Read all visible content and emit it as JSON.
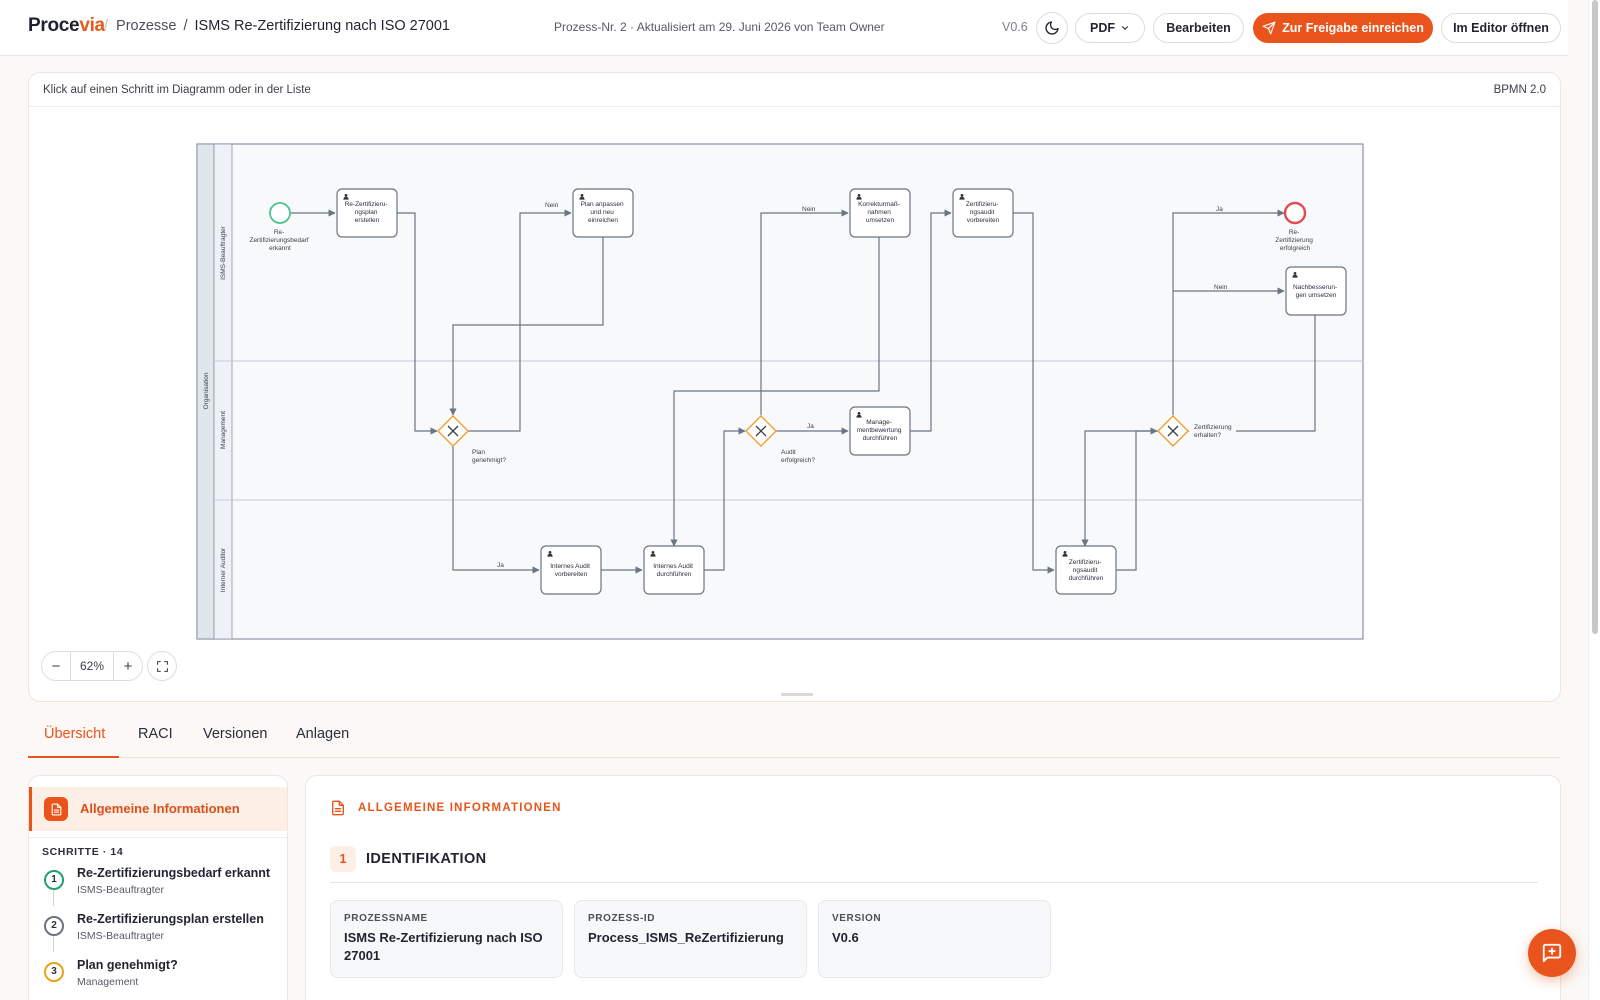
{
  "header": {
    "logo_main": "Proce",
    "logo_accent": "via",
    "breadcrumb_parent": "Prozesse",
    "breadcrumb_current": "ISMS Re-Zertifizierung nach ISO 27001",
    "meta": "Prozess-Nr. 2 · Aktualisiert am 29. Juni 2026 von Team Owner",
    "version": "V0.6",
    "pdf_label": "PDF",
    "edit_label": "Bearbeiten",
    "submit_label": "Zur Freigabe einreichen",
    "open_editor_label": "Im Editor öffnen"
  },
  "diagram": {
    "hint": "Klick auf einen Schritt im Diagramm oder in der Liste",
    "notation": "BPMN 2.0",
    "zoom": "62%",
    "pool": "Organisation",
    "lanes": [
      "ISMS-Beauftragter",
      "Management",
      "Interner Auditor"
    ],
    "start_event": [
      "Re-",
      "Zertifizierungsbedarf",
      "erkannt"
    ],
    "end_event": [
      "Re-",
      "Zertifizierung",
      "erfolgreich"
    ],
    "tasks": {
      "plan": [
        "Re-Zertifizieru-",
        "ngsplan",
        "erstellen"
      ],
      "anpassen": [
        "Plan anpassen",
        "und neu",
        "einreichen"
      ],
      "korrektur": [
        "Korrekturmaß-",
        "nahmen",
        "umsetzen"
      ],
      "zvorbereiten": [
        "Zertifizieru-",
        "ngsaudit",
        "vorbereiten"
      ],
      "nachbessern": [
        "Nachbesserun-",
        "gen umsetzen"
      ],
      "mgmt": [
        "Manage-",
        "mentbewertung",
        "durchführen"
      ],
      "iavorbereiten": [
        "Internes Audit",
        "vorbereiten"
      ],
      "iadurch": [
        "Internes Audit",
        "durchführen"
      ],
      "zdurch": [
        "Zertifizieru-",
        "ngsaudit",
        "durchführen"
      ]
    },
    "gateways": {
      "g1": [
        "Plan",
        "genehmigt?"
      ],
      "g2": [
        "Audit",
        "erfolgreich?"
      ],
      "g3": [
        "Zertifizierung",
        "erhalten?"
      ]
    },
    "flow_labels": {
      "yes": "Ja",
      "no": "Nein"
    }
  },
  "tabs": [
    "Übersicht",
    "RACI",
    "Versionen",
    "Anlagen"
  ],
  "sidebar": {
    "general_info": "Allgemeine Informationen",
    "steps_heading": "SCHRITTE · 14",
    "steps": [
      {
        "num": "1",
        "title": "Re-Zertifizierungsbedarf erkannt",
        "role": "ISMS-Beauftragter",
        "color": "#22a06b"
      },
      {
        "num": "2",
        "title": "Re-Zertifizierungsplan erstellen",
        "role": "ISMS-Beauftragter",
        "color": "#6b7280"
      },
      {
        "num": "3",
        "title": "Plan genehmigt?",
        "role": "Management",
        "color": "#e8a317"
      }
    ]
  },
  "main": {
    "section_title": "ALLGEMEINE INFORMATIONEN",
    "ident_num": "1",
    "ident_title": "IDENTIFIKATION",
    "fields": [
      {
        "label": "PROZESSNAME",
        "value": "ISMS Re-Zertifizierung nach ISO 27001"
      },
      {
        "label": "PROZESS-ID",
        "value": "Process_ISMS_ReZertifizierung"
      },
      {
        "label": "VERSION",
        "value": "V0.6"
      }
    ]
  },
  "colors": {
    "accent": "#e8541b",
    "start_event": "#4cc38a",
    "end_event": "#e5484d",
    "gateway": "#f0a030"
  }
}
